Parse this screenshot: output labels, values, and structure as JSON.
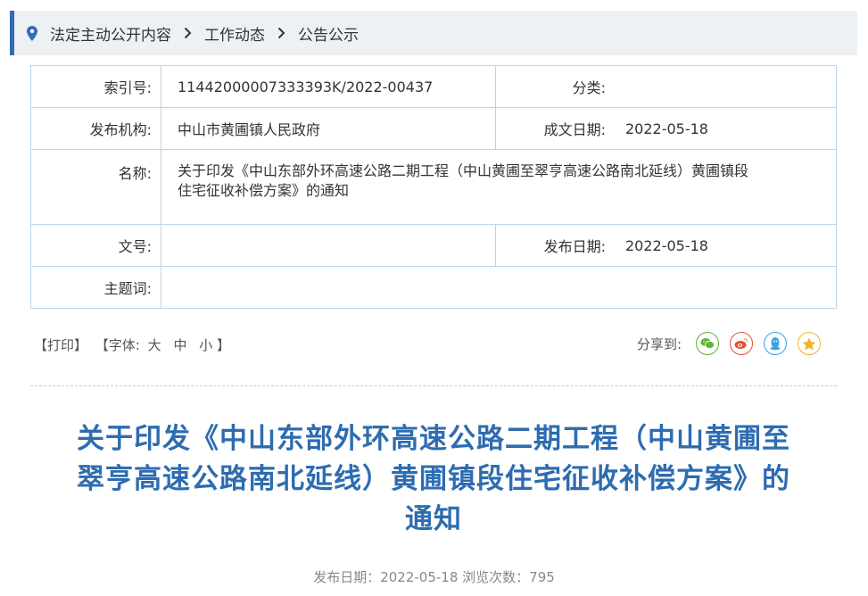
{
  "breadcrumb": {
    "items": [
      "法定主动公开内容",
      "工作动态",
      "公告公示"
    ]
  },
  "meta": {
    "index_label": "索引号:",
    "index_value": "11442000007333393K/2022-00437",
    "category_label": "分类:",
    "category_value": "",
    "org_label": "发布机构:",
    "org_value": "中山市黄圃镇人民政府",
    "written_date_label": "成文日期:",
    "written_date_value": "2022-05-18",
    "name_label": "名称:",
    "name_value_line1": "关于印发《中山东部外环高速公路二期工程（中山黄圃至翠亨高速公路南北延线）黄圃镇段",
    "name_value_line2": "住宅征收补偿方案》的通知",
    "doc_no_label": "文号:",
    "doc_no_value": "",
    "pub_date_label": "发布日期:",
    "pub_date_value": "2022-05-18",
    "keywords_label": "主题词:",
    "keywords_value": ""
  },
  "tools": {
    "print": "【打印】",
    "font_prefix": "【字体:",
    "size_large": "大",
    "size_medium": "中",
    "size_small": "小",
    "font_suffix": "】"
  },
  "share": {
    "label": "分享到:",
    "icons": [
      "wechat-icon",
      "weibo-icon",
      "qq-icon",
      "qzone-icon"
    ],
    "colors": {
      "wechat": "#5cb531",
      "weibo": "#e6522c",
      "qq": "#3ba3e0",
      "qzone": "#f2b329"
    }
  },
  "article": {
    "title_line1": "关于印发《中山东部外环高速公路二期工程（中山黄圃至",
    "title_line2": "翠亨高速公路南北延线）黄圃镇段住宅征收补偿方案》的",
    "title_line3": "通知",
    "pub_info": "发布日期：2022-05-18  浏览次数：795"
  },
  "colors": {
    "accent": "#2f6db5",
    "title": "#2e6cb0",
    "border": "#b9d3ea"
  }
}
